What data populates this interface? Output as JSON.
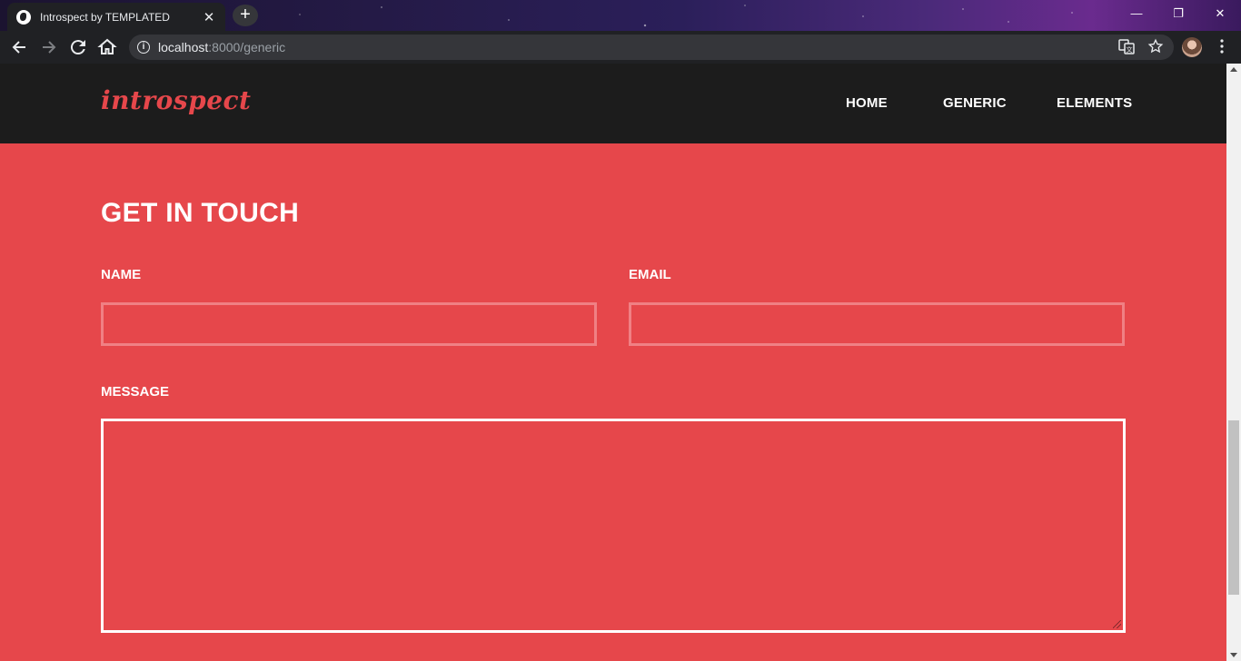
{
  "browser": {
    "tab_title": "Introspect by TEMPLATED",
    "new_tab_label": "+",
    "close_tab_label": "✕",
    "minimize_label": "—",
    "restore_label": "❐",
    "close_window_label": "✕",
    "url_host": "localhost",
    "url_rest": ":8000/generic"
  },
  "site": {
    "logo": "introspect",
    "nav": [
      "HOME",
      "GENERIC",
      "ELEMENTS"
    ]
  },
  "contact": {
    "title": "GET IN TOUCH",
    "name_label": "NAME",
    "email_label": "EMAIL",
    "message_label": "MESSAGE",
    "name_value": "",
    "email_value": "",
    "message_value": ""
  },
  "colors": {
    "accent": "#e6474b",
    "header_bg": "#1c1c1c",
    "field_border": "#f08084"
  }
}
